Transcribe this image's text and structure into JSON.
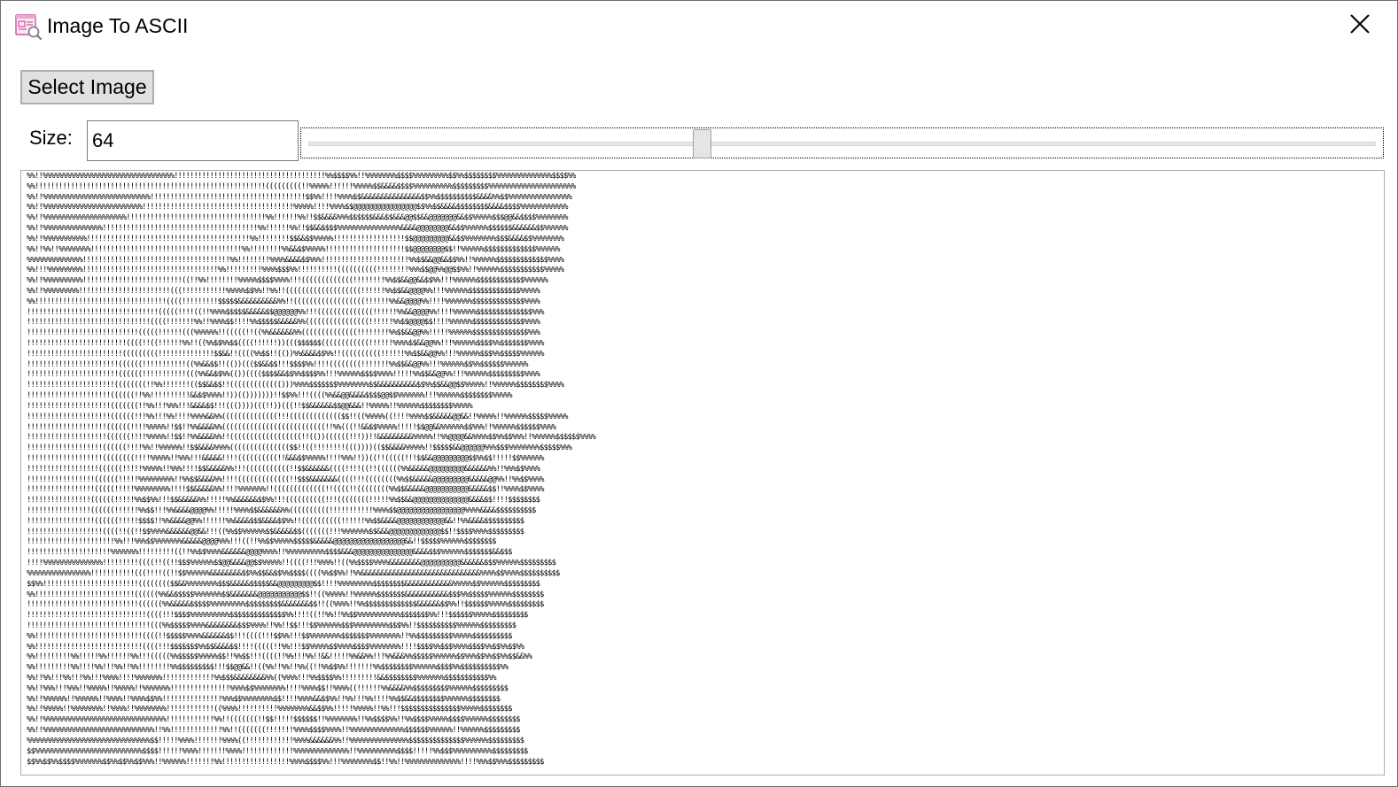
{
  "window": {
    "title": "Image To ASCII"
  },
  "toolbar": {
    "select_image_label": "Select Image"
  },
  "size_control": {
    "label": "Size:",
    "value": "64",
    "slider_value": 64,
    "slider_min": 8,
    "slider_max": 160
  },
  "icons": {
    "app": "image-search-icon",
    "close": "close-icon"
  },
  "colors": {
    "button_face": "#e1e1e1",
    "border": "#adadad",
    "icon_accent": "#c7579c"
  },
  "ascii_output": [
    "%%!!%%%%%%%%%%%%%%%%%%%%%%%%%%%%%%%%%!!!!!!!!!!!!!!!!!!!!!!!!!!!!!!!!!!!!!!%%$$$$%%!!%%%%%%%%$$$$%%%%%%%%%$$%%$$$$$$$$%%%%%%%%%%%%%%$$$$%%",
    "%%!!!!!!!!!!!!!!!!!!!!!!!!!!!!!!!!!!!!!!!!!!!!!!!!!!!!!!!!!!(((((((((!!%%%%%!!!!!!%%%%%$$&&&&$$$$%%%%%%%%%%$$$$$$$$$%%%%%%%%%%%%%%%%%%%%%%",
    "%%!!%%%%%%%%%%%%%%%%%%%%%%%%%%%!!!!!!!!!!!!!!!!!!!!!!!!!!!!!!!!!!!!!!!$$%%!!!!%%%%$$&&&&&&&&&&&&&&&$$%%$$$$$$$$$$&&&&%%$$%%%%%%%%%%%%%%%%",
    "%%!!%%%%%%%%%%%%%%%%%%%%%%%%%!!!!!!!!!!!!!!!!!!!!!!!!!!!!!!!!!!!!!!%%%%%!!!!%%%%$$@@@@@@@@@@@@@@@@$$%%$$&&&&$$$$$$$$&&&&$$$$%%%%%%%%%%%%",
    "%%!!%%%%%%%%%%%%%%%%%%%%%!!!!!!!!!!!!!!!!!!!!!!!!!!!!!!!!!!!%%!!!!!!%%!!$$&&&&%%%$$$$$$&&&$$&&&@@$$&&@@@@@@@&&$$%%%%%$$$@@&&$$$$%%%%%%%%",
    "%%!!%%%%%%%%%%%%%%%!!!!!!!!!!!!!!!!!!!!!!!!!!!!!!!!!!!!!!!%%!!!!!!%%!!$$&&$$$$%%%%%%%%%%%%%%%%&&&&@@@@@@@@&&$$%%%%%%$$$$$$&&&&&&$$%%%%%%",
    "%%!!%%%%%%%%%%%!!!!!!!!!!!!!!!!!!!!!!!!!!!!!!!!!!!!!!!!!%%!!!!!!!!$$&&$$%%%%%!!!!!!!!!!!!!!!!!!$$@@@@@@@@@&&$$%%%%%%%%$$$&&&&$$%%%%%%%%",
    "%%!!%%!!%%%%%%%%!!!!!!!!!!!!!!!!!!!!!!!!!!!!!!!!!!!!!!%%!!!!!!!!%%&&$$%%%%%!!!!!!!!!!!!!!!!!!!!$$@@@@@@@@$$!!%%%%%%$$$$$$$$$$$$$%%%%%%",
    "%%%%%%%%%%%%%%!!!!!!!!!!!!!!!!!!!!!!!!!!!!!!!!!!!!!%%!!!!!!!!%%%%&&&&$$%%%!!!!!!!!!!!!!!!!!!!!!!%%$$&&@@&&$$%%!!%%%%%%$$$$$$$$$$$$$%%%%",
    "%%!!!%%%%%%%%%!!!!!!!!!!!!!!!!!!!!!!!!!!!!!!!!!!%%!!!!!!!!!%%%%$$$%%!!!!!!!!!!((((((((((!!!!!!!!%%%$$@@%%@@$$%%!!%%%%%%$$$$$$$$$$$%%%%%",
    "%%!!%%%%%%%%%%!!!!!!!!!!!!!!!!!!!!!!!!!((!!%%!!!!!!!!%%%%%$$$$%%%%!!!(((((((((((((!!!!!!!!%%$$&&@@&&$$%%!!!%%%%%%$$$$$$$$$$$$%%%%%%",
    "%%!!%%%%%%%%%!!!!!!!!!!!!!!!!!!!!!!!(((!!!!!!!!!!!%%%%%$$%%!!%%!!(((((((((((((((((((!!!!!!%%$$&&@@@@%%!!!%%%%%%$$$$$$$$$$$$$%%%%%",
    "%%!!!!!!!!!!!!!!!!!!!!!!!!!!!!!!!!!((((!!!!!!!!!$$$$$&&&&&&&&&&%%!!((((((((((((((((((!!!!!!%%&&@@@@%%!!!!%%%%%%%$$$$$$$$$$$$$%%%%",
    "!!!!!!!!!!!!!!!!!!!!!!!!!!!!!!!!!(((((!!!!((!!%%%%$$$$$&&&&&$$@@@@@@%%!!!((((((((((((((!!!!!!%%&&@@@@%%!!!!%%%%%%$$$$$$$$$$$$$$%%%",
    "!!!!!!!!!!!!!!!!!!!!!!!!!!!!!!!((((!!!!!!!%%!!%%%%$$!!!!%%$$$$$&&&&&%%((((((((((((((((!!!!!!%%$$@@@@$$!!!!%%%%%%$$$$$$$$$$$$$%%%%",
    "!!!!!!!!!!!!!!!!!!!!!!!!!!!!(((((!!!!!!(((%%%%%%!!(((((!!((%%&&&&&&%%((((((((((((((!!!!!!!!%%$$&&@@%%!!!!!%%%%%%$$$$$$$$$$$$$$%%%",
    "!!!!!!!!!!!!!!!!!!!!!!!!!((((!!((!!!!!!%%!!((%%$$%%$$((((!!!!!!))((($$$$$$((((((((((((!!!!!!%%%%$$&&@@%%!!!%%%%%%$$$$%%$$$$$$$%%%%",
    "!!!!!!!!!!!!!!!!!!!!!!!!(((((((((!!!!!!!!!!!!!!$$&&!!((((%%$$!!(())%%&&&&$$%%!!((((((((((!!!!!!%%$$&&@@%%!!!%%%%%%$$$%%$$$$$%%%%%%",
    "!!!!!!!!!!!!!!!!!!!!!!!((((((!!!!!!!!!!!((%%&&$$!!(())((($$&&$$!!!$$$$%%!!!!((((((((!!!!!!!%%$$&&@@%%!!!%%%%%%$$%%$$$$$$%%%%%%",
    "!!!!!!!!!!!!!!!!!!!!!!!((((((!!!!!!!!!!!(((%%&&$$%%(())(((($$$$&&$$%%$$$$%%!!!%%%%%%$$$$%%%%!!!!!%%$$&&@@%%!!!%%%%%%$$$$$$$$$%%%%",
    "!!!!!!!!!!!!!!!!!!!!!!((((((((!!%%!!!!!!!(($$&&$$!!((((((((((((()))%%%%$$$$$$$%%%%%%%%$$&&&&&&&&&&$$%%$$&&@@$$%%%%%!!%%%%%%$$$$$$$$%%%%",
    "!!!!!!!!!!!!!!!!!!!!!((((((!!%%!!!!!!!!!!&&$$%%%%!!))(()))))))!!$$%%!!!((((%%&&@@&&&&$$$$@@$$%%%%%%%!!!%%%%%%$$$$$$$$%%%%%",
    "!!!!!!!!!!!!!!!!!!!!!(((((((!!%%!!!%%%!!!&&&&$$!!!((())))(((!!))(((!!$$&&&&&&$$@@&&&!!%%%%%!!%%%%%%$$$$$$$$%%%%%",
    "!!!!!!!!!!!!!!!!!!!!!((((((!!!%%!!!%%!!!!%%%%&&%%((((((((((((((!!!((((((((((((($$!!((%%%%%((!!!!%%%%$$&&&&&@@&&!!%%%%%!!%%%%%%$$$$$%%%%%",
    "!!!!!!!!!!!!!!!!!!!!((((((!!!!%%%%%!!$$!!%%&&&&%%((((((((((((((((((((((((((!!%%(((!!&&$$%%%%%!!!!!$$@@&&%%%%%%$$%%%!!%%%%%%$$$$$$%%%%",
    "!!!!!!!!!!!!!!!!!!!!((((((!!!!%%%%%!!$$!!%%&&&&%%!!((((((((((((((((((!!(())((((((!!!))!!&&&&&&&&&%%%%%!!%%@@@@&&%%%%$$%%$$%%%!!%%%%%%$$$$$$%%%%",
    "!!!!!!!!!!!!!!!!!!!((((((!!!!%%!!%%%%%%!!$$&&&&%%%%((((((((((((((($$!!((!!!!!!!!((())))(($$&&&&%%%%%!!$$$$$&&@@@@@@%%%$$$%%%%%%%%$$$$$%%%",
    "!!!!!!!!!!!!!!!!!!!((((((((!!!!%%%%%!!%%%!!!&&&&&!!!!((((((((((!!&&&$$%%%%%!!!!%%%!!))((!!(((((!!!$$&&@@@@@@@@@$$%%$$!!!!!$$%%%%%%",
    "!!!!!!!!!!!!!!!!!!((((((!!!!!%%%%%!!%%%!!!!$$&&&&&%%!!!(((((((((((!!$$&&&&&&((((!!!!((!!((((((%%&&&&&@@@@@@@@@&&&&&&%%!!%%%$$%%%%",
    "!!!!!!!!!!!!!!!!!((((((!!!!!%%%%%%%%%!!%%$$&&&&%%!!!!(((((((((((((!!$$$&&&&&&&((((!!!((((((((%%$$&&&&&@@@@@@@@@&&&&&@@%%!!%%$$%%%%",
    "!!!!!!!!!!!!!!!!!(((((!!!!!%%%%%%%%%!!!!$$&&&&&%%!!!!%%%%%%%!!(((((((((((((!!((((!!((((((((%%$$&&&&&@@@@@@@@@@@&&&&&$$!!%%%%$$%%%%",
    "!!!!!!!!!!!!!!!!((((((!!!!!%%$$%%!!!$$&&&&&%%!!!!!%%&&&&&&$$%%!!!((((((((((!!!((((((((!!!!!%%$$&&@@@@@@@@@@@@@@&&&&$$!!!!$$$$$$$$",
    "!!!!!!!!!!!!!!!!((((((!!!!!!%%$$!!!%%&&&&@@@@%%!!!!!%%%%$$&&&&&&%%((((((((((!!!!!!!!!!!%%%%$$@@@@@@@@@@@@@@@@@%%%%&&&&$$$$$$$$$$",
    "!!!!!!!!!!!!!!!!!((((((!!!!!$$$$!!%%&&&&@@%%!!!!!!%%&&&&$$$&&&&$$%%!!((((((((((!!!!!!%%$$&&&&@@@@@@@@@@@@&&!!%%&&&&$$$$$$$$$$",
    "!!!!!!!!!!!!!!!!!!!((((!!((!!$$%%%%&&&&&&@@&&!!!((%%$$%%%%%%$$&&&&&$$(((((((!!!%%%%%%%$$&&&@@@@@@@@@@@@@$$!!$$$$%%%%$$$$$$$$$",
    "!!!!!!!!!!!!!!!!!!!!!!%%!!!%%%$$%%%%%%%&&&&&@@@@%%%!!!((!!%%$$%%%%%$$$$$&&&&&@@@@@@@@@@@@@@@@@@&&!!$$$$$%%%%%%$$$$$$$$",
    "!!!!!!!!!!!!!!!!!!!!!%%%%%%%!!!!!!!!!((!!%%$$%%%%&&&&&&@@@@%%%%!!%%%%%%%%%%$$$$&&&@@@@@@@@@@@@@@@&&&&$$$%%%%%%$$$$$$$&&$$$",
    "!!!!%%%%%%%%%%%%%%%!!!!!!!!!((((!!((!!$$$%%%%%%$$@@&&&&@@$$%%%%%!!((((!!!%%%%!!((%%$$$$%%%%&&&&&&&&@@@@@@@@@@&&&&&&$$$%%%%%%$$$$$$$$$",
    "%%%%%%%%%%%%%%%%!!!!!!!!!!!(((!!!!((!!$$%%%%%%&&&&&&&&$$%%$$&&$$%%$$$$((((%%$$%%!!%%&&&&&&&&&&&&&&&&&&&&&&&&&&&&&&%%%%$$%%%%$$$$$$$$$$",
    "$$%%!!!!!!!!!!!!!!!!!!!!!!!!(((((((($$&&%%%%%%%%$$$&&&&&$$$$$&&@@@@@@@@@$$!!!!%%%%%%%%%$$$$$$$$&&&&&&&&&&&&%%%%%$$%%%%%%$$$$$$$$$",
    "%%!!!!!!!!!!!!!!!!!!!!!!!!!((((((%%&&$$$$$%%%%%%%$$&&&&&&&@@@@@@@@@@@$$!!((%%%%%!!%%%%%%$$$$$$$&&&&&&&&&&&$$$%%$$$$$%%%%%%$$$$$$$$",
    "!!!!!!!!!!!!!!!!!!!!!!!!!!!!((((((%%&&&&&$$$$$%%%%%%%%%$$$$$$$$$&&&&&&&$$!!((%%%%!!%%$$$$$$$$$$$$$&&&&&&$$%%!!$$$$$$%%%%%$$$$$$$$$",
    "!!!!!!!!!!!!!!!!!!!!!!!!!!!!!!((((!!!$$$$%%%%%%%%%%$$$$$$$$$$$$$$%%!!!!((!!%%!!%%$$%%%%%%%%%%%$$$$$$$%%!!!$$$$$$%%%%%$$$$$$$$$",
    "!!!!!!!!!!!!!!!!!!!!!!!!!!!!!!!(((%%$$$$$%%%%&&&&&&&&$$$%%%%!!%%!!$$!!!$$%%%%%%$$$%%%%%%%%%$$$%%!!$$$$$$$$$$%%%%%%$$$$$$$$$",
    "%%!!!!!!!!!!!!!!!!!!!!!!!!!!!((((!!$$$$$%%%%&&&&&&$$!!!((((!!!$$%%!!!$$%%%%%%%%$$$$$$$%%%%%%%%!!%%$$$$$$$$$%%%%%$$$$$$$$$$",
    "%%!!!!!!!!!!!!!!!!!!!!!!!!!!!((((!!!$$$$$$$%%$$&&&&$$!!!!(((((!!%%!!!$$%%%%%$$%%%%$$$$%%%%%%%%!!!!$$$$%%$$$%%%%$$$$%%$$%%$$%%",
    "%%!!!!!!!!!%%!!!!!%%!!!!!!%%!!!(((((%%$$$$$%%%%%$$!!%%$$!!!((((!!%%!!!%%!!&&!!!!!%%&&%%!!!%%&&&%%$$$$$%%%%%%$$%%%$$%%$$%%$$&&%%",
    "%%!!!!!!!!!%%!!!!%%!!!%%!!%%!!!!!!!!%%$$$$$$$$$!!!$$@@&&!!((%%!!%%!!%%((!!%%$$%%!!!!!!!%%$$$$$$$$%%%%%%$$$$%%$$$$$$$$$$%%",
    "%%!!%%!!!%%!!!%%!!!%%%%!!!!%%%%%%%!!!!!!!!!!!!!%%$$$&&&&&&&&%%((%%%%!!!%%$$$$%%!!!!!!!!!&&$$$$$$$$%%%%%%%$$$$$$$$$$$%%",
    "%%!!%%%!!!%%%!!%%%%%!!%%%%%!!%%%%%%%!!!!!!!!!!!!!!!%%%%$$%%%%%%%%!!!!%%%%$$!!%%%%((!!!!!!%%&&&&%%$$$$$$$$$%%%%%%$$$$$$$$$",
    "%%!!%%%%%%!!%%%%%%!!%%%%!!%%%%$$%%!!!!!!!!!!!!!!!%%%$$%%%%%%%%$$!!!!%%%%&&$$%%!!%%!!!%%!!!!%%$$&&$$$$$$$$%%%%%%$$$$$$$$",
    "%%!!%%%%%!!%%%%%%%%!!%%%%!!%%%%%%%%!!!!!!!!!!!!((%%%%!!!!!!!!!!%%%%%%%%&&$$%%!!!!!%%%%%!!%%!!!$$$$$$$$$$$$$$$%%%%%$$$$$$$$",
    "%%!!%%%%%%%%%%%%%%%%%%%%%%%%%%%%%%%!!!!!!!!!!!!%%!!(((((((!!$$!!!!!$$$$$$!!%%%%%%%%!!%%$$$$%%!!%%$$$$%%%%%$$$$%%%%%%$$$$$$$$",
    "%%!!%%%%%%%%%%%%%%%%%%%%%%%%%%%%!!%%!!!!!!!!!!!!!%%!!(((((((!!!!!!!%%%%$$$$%%%%!!%%%%%%%%%%%%%%$$$$$$%%%%%%!!%%%%%%$$$$$$$$$",
    "%%%%%%%%%%%%%%%%%%%%%%%%%%%%%%%$$!!!!!%%%%!!!!!!!%%%%((!!!!!!!!!!!!%%%%&&&&&&%%!!%%%%%%%%%%%%%%%$$$$$$$$$$$$$$%%%%%%$$$$$$$$$",
    "$$%%%%%%%%%%%%%%%%%%%%%%%%%%%$$$$!!!!!!%%%%!!!!!!!%%%%!!!!!!!!!!!!!%%%%%%%%%%%%%%!!%%%%%%%%%%$$$$!!!!!%%$$$%%%%%%%%%%$$$$$$$$$",
    "$$%%$$%%$$$$%%%%%%%$$%%$$%%$$%%%!!%%%%%%!!!!!!!%%!!!!!!!!!!!!!!!!!%%%%$$$$%%!!!%%%%%%%%$$!!%%!!%%%%%%%%%%%%%%!!!!%%%$$%%%$$$$$$$$$"
  ]
}
